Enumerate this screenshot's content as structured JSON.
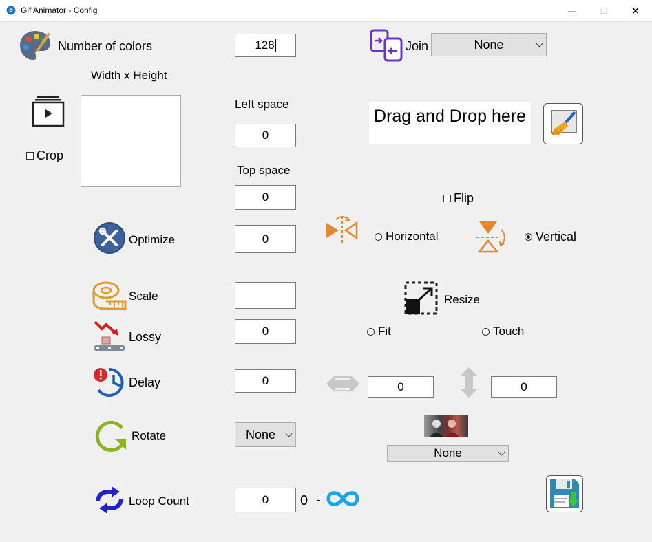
{
  "window": {
    "title": "Gif Animator - Config",
    "minimize": "—",
    "maximize": "☐",
    "close": "✕"
  },
  "colors": {
    "label": "Number of colors",
    "value": "128"
  },
  "join": {
    "label": "Join",
    "selected": "None"
  },
  "size": {
    "label": "Width x Height"
  },
  "crop": {
    "label": "Crop",
    "checked": false
  },
  "left_space": {
    "label": "Left space",
    "value": "0"
  },
  "top_space": {
    "label": "Top space",
    "value": "0"
  },
  "drop": {
    "text": "Drag and Drop here"
  },
  "flip": {
    "label": "Flip",
    "checked": false,
    "horizontal_label": "Horizontal",
    "vertical_label": "Vertical",
    "selected": "Vertical"
  },
  "optimize": {
    "label": "Optimize",
    "value": "0"
  },
  "scale": {
    "label": "Scale",
    "value": ""
  },
  "resize": {
    "label": "Resize",
    "fit_label": "Fit",
    "touch_label": "Touch"
  },
  "lossy": {
    "label": "Lossy",
    "value": "0"
  },
  "delay": {
    "label": "Delay",
    "value": "0"
  },
  "dims": {
    "width_value": "0",
    "height_value": "0"
  },
  "rotate": {
    "label": "Rotate",
    "selected": "None"
  },
  "filter": {
    "selected": "None"
  },
  "loop": {
    "label": "Loop Count",
    "value": "0",
    "hint_zero": "0",
    "hint_dash": "-"
  }
}
